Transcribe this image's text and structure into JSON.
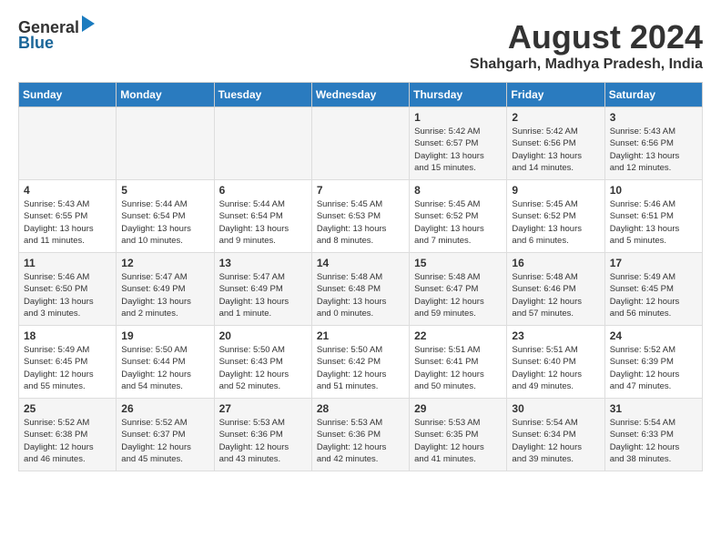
{
  "header": {
    "logo_general": "General",
    "logo_blue": "Blue",
    "month_year": "August 2024",
    "location": "Shahgarh, Madhya Pradesh, India"
  },
  "days_of_week": [
    "Sunday",
    "Monday",
    "Tuesday",
    "Wednesday",
    "Thursday",
    "Friday",
    "Saturday"
  ],
  "weeks": [
    [
      {
        "day": "",
        "info": ""
      },
      {
        "day": "",
        "info": ""
      },
      {
        "day": "",
        "info": ""
      },
      {
        "day": "",
        "info": ""
      },
      {
        "day": "1",
        "info": "Sunrise: 5:42 AM\nSunset: 6:57 PM\nDaylight: 13 hours\nand 15 minutes."
      },
      {
        "day": "2",
        "info": "Sunrise: 5:42 AM\nSunset: 6:56 PM\nDaylight: 13 hours\nand 14 minutes."
      },
      {
        "day": "3",
        "info": "Sunrise: 5:43 AM\nSunset: 6:56 PM\nDaylight: 13 hours\nand 12 minutes."
      }
    ],
    [
      {
        "day": "4",
        "info": "Sunrise: 5:43 AM\nSunset: 6:55 PM\nDaylight: 13 hours\nand 11 minutes."
      },
      {
        "day": "5",
        "info": "Sunrise: 5:44 AM\nSunset: 6:54 PM\nDaylight: 13 hours\nand 10 minutes."
      },
      {
        "day": "6",
        "info": "Sunrise: 5:44 AM\nSunset: 6:54 PM\nDaylight: 13 hours\nand 9 minutes."
      },
      {
        "day": "7",
        "info": "Sunrise: 5:45 AM\nSunset: 6:53 PM\nDaylight: 13 hours\nand 8 minutes."
      },
      {
        "day": "8",
        "info": "Sunrise: 5:45 AM\nSunset: 6:52 PM\nDaylight: 13 hours\nand 7 minutes."
      },
      {
        "day": "9",
        "info": "Sunrise: 5:45 AM\nSunset: 6:52 PM\nDaylight: 13 hours\nand 6 minutes."
      },
      {
        "day": "10",
        "info": "Sunrise: 5:46 AM\nSunset: 6:51 PM\nDaylight: 13 hours\nand 5 minutes."
      }
    ],
    [
      {
        "day": "11",
        "info": "Sunrise: 5:46 AM\nSunset: 6:50 PM\nDaylight: 13 hours\nand 3 minutes."
      },
      {
        "day": "12",
        "info": "Sunrise: 5:47 AM\nSunset: 6:49 PM\nDaylight: 13 hours\nand 2 minutes."
      },
      {
        "day": "13",
        "info": "Sunrise: 5:47 AM\nSunset: 6:49 PM\nDaylight: 13 hours\nand 1 minute."
      },
      {
        "day": "14",
        "info": "Sunrise: 5:48 AM\nSunset: 6:48 PM\nDaylight: 13 hours\nand 0 minutes."
      },
      {
        "day": "15",
        "info": "Sunrise: 5:48 AM\nSunset: 6:47 PM\nDaylight: 12 hours\nand 59 minutes."
      },
      {
        "day": "16",
        "info": "Sunrise: 5:48 AM\nSunset: 6:46 PM\nDaylight: 12 hours\nand 57 minutes."
      },
      {
        "day": "17",
        "info": "Sunrise: 5:49 AM\nSunset: 6:45 PM\nDaylight: 12 hours\nand 56 minutes."
      }
    ],
    [
      {
        "day": "18",
        "info": "Sunrise: 5:49 AM\nSunset: 6:45 PM\nDaylight: 12 hours\nand 55 minutes."
      },
      {
        "day": "19",
        "info": "Sunrise: 5:50 AM\nSunset: 6:44 PM\nDaylight: 12 hours\nand 54 minutes."
      },
      {
        "day": "20",
        "info": "Sunrise: 5:50 AM\nSunset: 6:43 PM\nDaylight: 12 hours\nand 52 minutes."
      },
      {
        "day": "21",
        "info": "Sunrise: 5:50 AM\nSunset: 6:42 PM\nDaylight: 12 hours\nand 51 minutes."
      },
      {
        "day": "22",
        "info": "Sunrise: 5:51 AM\nSunset: 6:41 PM\nDaylight: 12 hours\nand 50 minutes."
      },
      {
        "day": "23",
        "info": "Sunrise: 5:51 AM\nSunset: 6:40 PM\nDaylight: 12 hours\nand 49 minutes."
      },
      {
        "day": "24",
        "info": "Sunrise: 5:52 AM\nSunset: 6:39 PM\nDaylight: 12 hours\nand 47 minutes."
      }
    ],
    [
      {
        "day": "25",
        "info": "Sunrise: 5:52 AM\nSunset: 6:38 PM\nDaylight: 12 hours\nand 46 minutes."
      },
      {
        "day": "26",
        "info": "Sunrise: 5:52 AM\nSunset: 6:37 PM\nDaylight: 12 hours\nand 45 minutes."
      },
      {
        "day": "27",
        "info": "Sunrise: 5:53 AM\nSunset: 6:36 PM\nDaylight: 12 hours\nand 43 minutes."
      },
      {
        "day": "28",
        "info": "Sunrise: 5:53 AM\nSunset: 6:36 PM\nDaylight: 12 hours\nand 42 minutes."
      },
      {
        "day": "29",
        "info": "Sunrise: 5:53 AM\nSunset: 6:35 PM\nDaylight: 12 hours\nand 41 minutes."
      },
      {
        "day": "30",
        "info": "Sunrise: 5:54 AM\nSunset: 6:34 PM\nDaylight: 12 hours\nand 39 minutes."
      },
      {
        "day": "31",
        "info": "Sunrise: 5:54 AM\nSunset: 6:33 PM\nDaylight: 12 hours\nand 38 minutes."
      }
    ]
  ]
}
